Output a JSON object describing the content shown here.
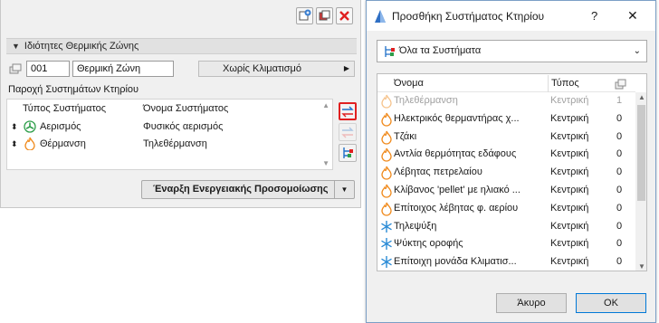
{
  "left_panel": {
    "section_title": "Ιδιότητες Θερμικής Ζώνης",
    "zone_number": "001",
    "zone_name": "Θερμική Ζώνη",
    "hvac_value": "Χωρίς Κλιματισμό",
    "systems_label": "Παροχή Συστημάτων Κτηρίου",
    "table_headers": {
      "type": "Τύπος Συστήματος",
      "name": "Όνομα Συστήματος"
    },
    "rows": [
      {
        "type": "Αερισμός",
        "name": "Φυσικός αερισμός",
        "icon": "ventilation-icon"
      },
      {
        "type": "Θέρμανση",
        "name": "Τηλεθέρμανση",
        "icon": "flame-icon"
      }
    ],
    "start_button": "Έναρξη Ενεργειακής Προσομοίωσης"
  },
  "dialog": {
    "title": "Προσθήκη Συστήματος Κτηρίου",
    "help": "?",
    "close": "✕",
    "filter_value": "Όλα τα Συστήματα",
    "columns": {
      "name": "Όνομα",
      "type": "Τύπος"
    },
    "items": [
      {
        "name": "Τηλεθέρμανση",
        "type": "Κεντρική",
        "count": "1",
        "icon": "flame-icon",
        "disabled": true
      },
      {
        "name": "Ηλεκτρικός θερμαντήρας χ...",
        "type": "Κεντρική",
        "count": "0",
        "icon": "flame-icon"
      },
      {
        "name": "Τζάκι",
        "type": "Κεντρική",
        "count": "0",
        "icon": "flame-icon"
      },
      {
        "name": "Αντλία θερμότητας εδάφους",
        "type": "Κεντρική",
        "count": "0",
        "icon": "flame-icon"
      },
      {
        "name": "Λέβητας πετρελαίου",
        "type": "Κεντρική",
        "count": "0",
        "icon": "flame-icon"
      },
      {
        "name": "Κλίβανος 'pellet' με ηλιακό ...",
        "type": "Κεντρική",
        "count": "0",
        "icon": "flame-icon"
      },
      {
        "name": "Επίτοιχος λέβητας φ. αερίου",
        "type": "Κεντρική",
        "count": "0",
        "icon": "flame-icon"
      },
      {
        "name": "Τηλεψύξη",
        "type": "Κεντρική",
        "count": "0",
        "icon": "snowflake-icon"
      },
      {
        "name": "Ψύκτης οροφής",
        "type": "Κεντρική",
        "count": "0",
        "icon": "snowflake-icon"
      },
      {
        "name": "Επίτοιχη μονάδα Κλιματισ...",
        "type": "Κεντρική",
        "count": "0",
        "icon": "snowflake-icon"
      }
    ],
    "cancel_label": "Άκυρο",
    "ok_label": "OK"
  },
  "colors": {
    "accent_red": "#e02020",
    "flame": "#f08a1c",
    "snow": "#2a8bd6",
    "vent": "#2e9e4a"
  }
}
